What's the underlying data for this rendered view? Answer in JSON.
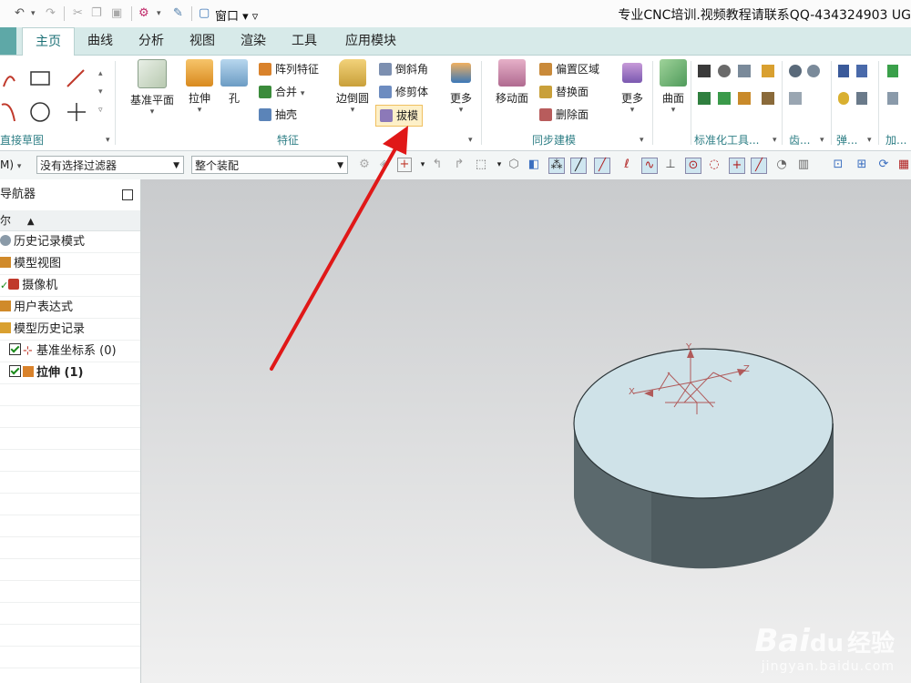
{
  "title_bar": {
    "app_title": "专业CNC培训.视频教程请联系QQ-434324903 UG",
    "window_menu_label": "窗口"
  },
  "tabs": [
    "主页",
    "曲线",
    "分析",
    "视图",
    "渲染",
    "工具",
    "应用模块"
  ],
  "ribbon": {
    "sketch_group_title": "直接草图",
    "buttons": {
      "datum_plane": "基准平面",
      "extrude": "拉伸",
      "hole": "孔",
      "pattern_feature": "阵列特征",
      "unite": "合并",
      "shell": "抽壳",
      "edge_blend": "边倒圆",
      "chamfer": "倒斜角",
      "trim_body": "修剪体",
      "draft": "拔模",
      "more1": "更多",
      "move_face": "移动面",
      "offset_region": "偏置区域",
      "replace_face": "替换面",
      "delete_face": "删除面",
      "more2": "更多",
      "surface": "曲面"
    },
    "group_titles": {
      "feature": "特征",
      "sync_modeling": "同步建模",
      "standard_tools": "标准化工具...",
      "gear": "齿...",
      "spring": "弹...",
      "add": "加..."
    }
  },
  "toolbar": {
    "filter_combo": "没有选择过滤器",
    "assembly_combo": "整个装配",
    "mode_combo": "M)"
  },
  "navigator": {
    "title": "导航器",
    "column_header": "尔",
    "items": [
      {
        "label": "历史记录模式",
        "bold": false
      },
      {
        "label": "模型视图",
        "bold": false
      },
      {
        "label": "摄像机",
        "bold": false
      },
      {
        "label": "用户表达式",
        "bold": false
      },
      {
        "label": "模型历史记录",
        "bold": false
      },
      {
        "label": "基准坐标系 (0)",
        "bold": false
      },
      {
        "label": "拉伸 (1)",
        "bold": true
      }
    ]
  },
  "viewport": {
    "axis_labels": {
      "y": "Y",
      "x": "X",
      "z": "Z"
    },
    "watermark_brand": "Bai",
    "watermark_brand2": "经验",
    "watermark_url": "jingyan.baidu.com"
  },
  "colors": {
    "annotation_arrow": "#e01818",
    "cylinder_top": "#cfe2e8",
    "cylinder_side": "#4d5b5f"
  }
}
